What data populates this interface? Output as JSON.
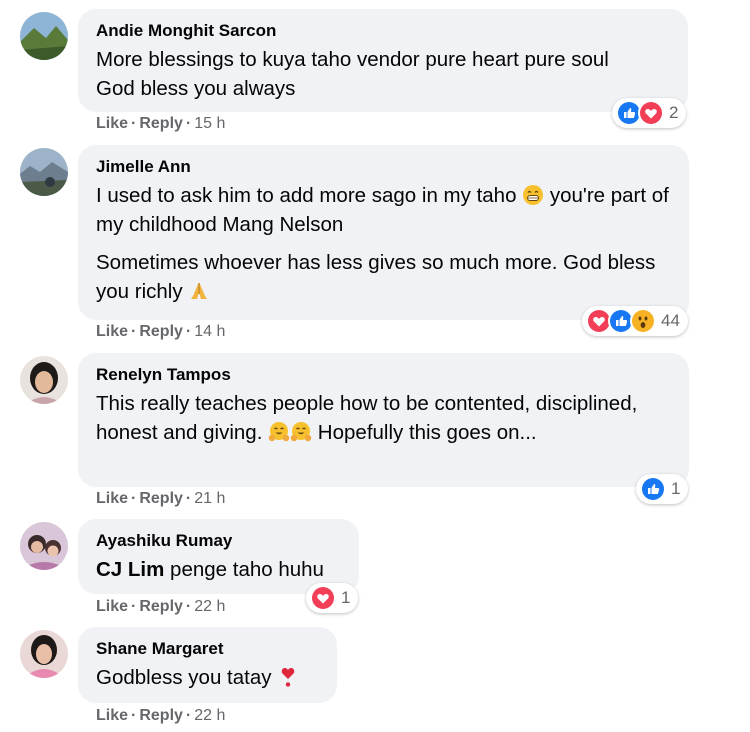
{
  "colors": {
    "bubble_bg": "#f0f2f5",
    "meta_text": "#65676b",
    "like_blue": "#1877f2",
    "love_red": "#f33e58",
    "wow_yellow": "#f7b125"
  },
  "comments": [
    {
      "author": "Andie Monghit Sarcon",
      "paragraphs": [
        "More blessings to kuya taho vendor pure heart pure soul",
        "God bless you always"
      ],
      "actions": {
        "like": "Like",
        "reply": "Reply",
        "time": "15 h"
      },
      "reactions": {
        "icons": [
          "like-icon",
          "love-icon"
        ],
        "count": "2"
      }
    },
    {
      "author": "Jimelle Ann",
      "p1_before": "I used to ask him to add more sago in my taho ",
      "p1_after": " you're part of my childhood Mang Nelson",
      "p2_before": "Sometimes whoever has less gives so much more. God bless you richly ",
      "actions": {
        "like": "Like",
        "reply": "Reply",
        "time": "14 h"
      },
      "reactions": {
        "icons": [
          "love-icon",
          "like-icon",
          "wow-icon"
        ],
        "count": "44"
      }
    },
    {
      "author": "Renelyn Tampos",
      "text_before": "This really teaches people how to be contented, disciplined, honest and giving. ",
      "text_after": " Hopefully this goes on...",
      "actions": {
        "like": "Like",
        "reply": "Reply",
        "time": "21 h"
      },
      "reactions": {
        "icons": [
          "like-icon"
        ],
        "count": "1"
      }
    },
    {
      "author": "Ayashiku Rumay",
      "mention": "CJ Lim",
      "text_after": " penge taho huhu",
      "actions": {
        "like": "Like",
        "reply": "Reply",
        "time": "22 h"
      },
      "reactions": {
        "icons": [
          "love-icon"
        ],
        "count": "1"
      }
    },
    {
      "author": "Shane Margaret",
      "text_before": "Godbless you tatay ",
      "actions": {
        "like": "Like",
        "reply": "Reply",
        "time": "22 h"
      }
    }
  ]
}
